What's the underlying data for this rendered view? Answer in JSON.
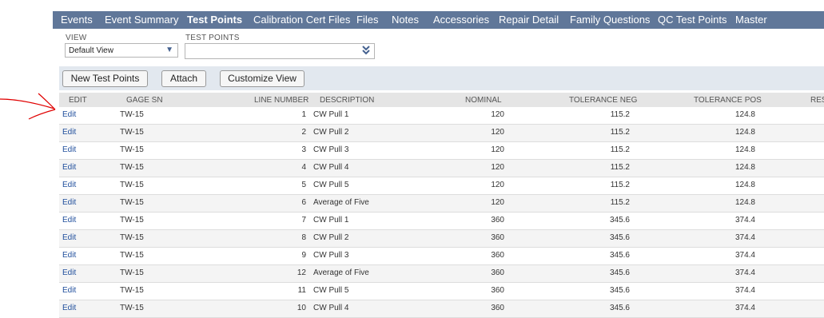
{
  "tabs": [
    "Events",
    "Event Summary",
    "Test Points",
    "Calibration Cert Files",
    "Files",
    "Notes",
    "Accessories",
    "Repair Detail",
    "Family Questions",
    "QC Test Points",
    "Master"
  ],
  "active_tab": "Test Points",
  "filters": {
    "view_label": "VIEW",
    "view_value": "Default View",
    "test_points_label": "TEST POINTS",
    "test_points_value": ""
  },
  "toolbar": {
    "new_label": "New Test Points",
    "attach_label": "Attach",
    "customize_label": "Customize View"
  },
  "columns": [
    "EDIT",
    "GAGE SN",
    "LINE NUMBER",
    "DESCRIPTION",
    "NOMINAL",
    "TOLERANCE NEG",
    "TOLERANCE POS",
    "RES"
  ],
  "rows": [
    {
      "edit": "Edit",
      "gage_sn": "TW-15",
      "line": "1",
      "desc": "CW Pull 1",
      "nominal": "120",
      "tol_neg": "115.2",
      "tol_pos": "124.8"
    },
    {
      "edit": "Edit",
      "gage_sn": "TW-15",
      "line": "2",
      "desc": "CW Pull 2",
      "nominal": "120",
      "tol_neg": "115.2",
      "tol_pos": "124.8"
    },
    {
      "edit": "Edit",
      "gage_sn": "TW-15",
      "line": "3",
      "desc": "CW Pull 3",
      "nominal": "120",
      "tol_neg": "115.2",
      "tol_pos": "124.8"
    },
    {
      "edit": "Edit",
      "gage_sn": "TW-15",
      "line": "4",
      "desc": "CW Pull 4",
      "nominal": "120",
      "tol_neg": "115.2",
      "tol_pos": "124.8"
    },
    {
      "edit": "Edit",
      "gage_sn": "TW-15",
      "line": "5",
      "desc": "CW Pull 5",
      "nominal": "120",
      "tol_neg": "115.2",
      "tol_pos": "124.8"
    },
    {
      "edit": "Edit",
      "gage_sn": "TW-15",
      "line": "6",
      "desc": "Average of Five",
      "nominal": "120",
      "tol_neg": "115.2",
      "tol_pos": "124.8"
    },
    {
      "edit": "Edit",
      "gage_sn": "TW-15",
      "line": "7",
      "desc": "CW Pull 1",
      "nominal": "360",
      "tol_neg": "345.6",
      "tol_pos": "374.4"
    },
    {
      "edit": "Edit",
      "gage_sn": "TW-15",
      "line": "8",
      "desc": "CW Pull 2",
      "nominal": "360",
      "tol_neg": "345.6",
      "tol_pos": "374.4"
    },
    {
      "edit": "Edit",
      "gage_sn": "TW-15",
      "line": "9",
      "desc": "CW Pull 3",
      "nominal": "360",
      "tol_neg": "345.6",
      "tol_pos": "374.4"
    },
    {
      "edit": "Edit",
      "gage_sn": "TW-15",
      "line": "12",
      "desc": "Average of Five",
      "nominal": "360",
      "tol_neg": "345.6",
      "tol_pos": "374.4"
    },
    {
      "edit": "Edit",
      "gage_sn": "TW-15",
      "line": "11",
      "desc": "CW Pull 5",
      "nominal": "360",
      "tol_neg": "345.6",
      "tol_pos": "374.4"
    },
    {
      "edit": "Edit",
      "gage_sn": "TW-15",
      "line": "10",
      "desc": "CW Pull 4",
      "nominal": "360",
      "tol_neg": "345.6",
      "tol_pos": "374.4"
    }
  ],
  "colors": {
    "tabbar": "#607799",
    "link": "#1f4e9c",
    "toolbar": "#e2e8ef",
    "annotation": "#e00000"
  },
  "icons": {
    "view_dropdown": "caret-down-icon",
    "test_points_dropdown": "double-chevron-down-icon",
    "annotation": "red-arrow-icon"
  }
}
